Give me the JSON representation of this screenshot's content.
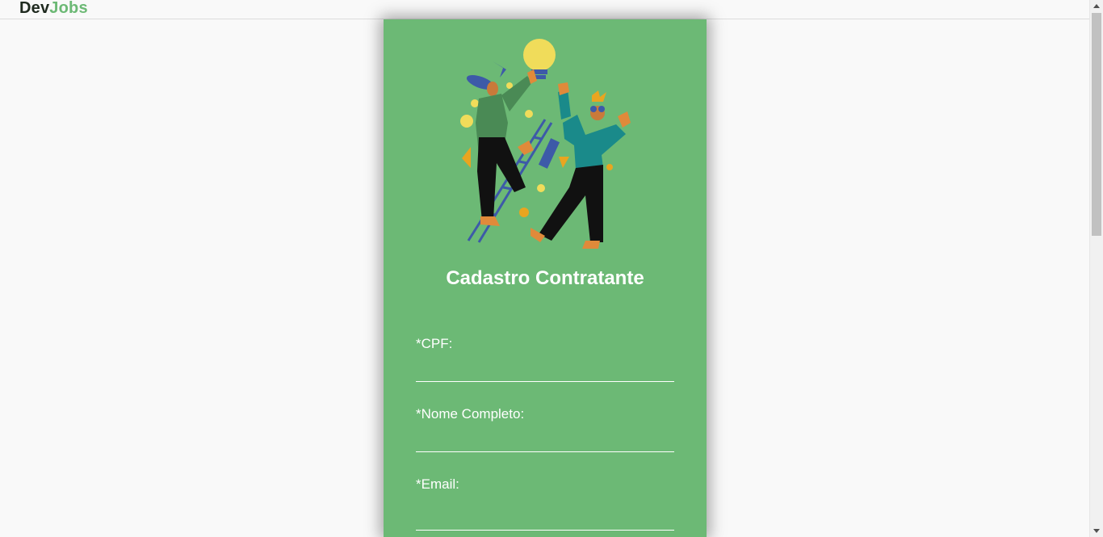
{
  "brand": {
    "part1": "Dev",
    "part2": "Jobs",
    "accent_color": "#6cb975"
  },
  "form": {
    "title": "Cadastro Contratante",
    "fields": [
      {
        "label": "*CPF:",
        "value": ""
      },
      {
        "label": "*Nome Completo:",
        "value": ""
      },
      {
        "label": "*Email:",
        "value": ""
      }
    ]
  },
  "colors": {
    "card_background": "#6cb975",
    "page_background": "#f9f9f9"
  },
  "icons": {
    "illustration": "people-lightbulb-ladder-illustration"
  }
}
